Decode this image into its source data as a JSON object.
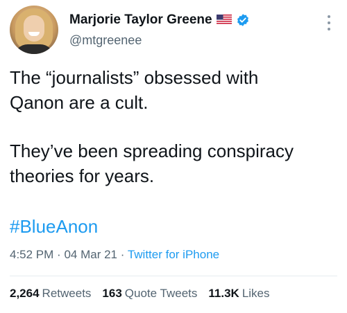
{
  "author": {
    "display_name": "Marjorie Taylor Greene",
    "handle": "@mtgreenee",
    "flag_icon": "us-flag-icon",
    "verified_icon": "verified-badge-icon",
    "accent": "#1d9bf0"
  },
  "tweet": {
    "paragraph1_line1": "The “journalists” obsessed with",
    "paragraph1_line2": "Qanon are a cult.",
    "paragraph2_line1": "They’ve been spreading conspiracy",
    "paragraph2_line2": "theories for years.",
    "hashtag": "#BlueAnon"
  },
  "meta": {
    "time": "4:52 PM",
    "separator": "·",
    "date": "04 Mar 21",
    "source": "Twitter for iPhone"
  },
  "stats": {
    "retweets_count": "2,264",
    "retweets_label": "Retweets",
    "quotes_count": "163",
    "quotes_label": "Quote Tweets",
    "likes_count": "11.3K",
    "likes_label": "Likes"
  }
}
